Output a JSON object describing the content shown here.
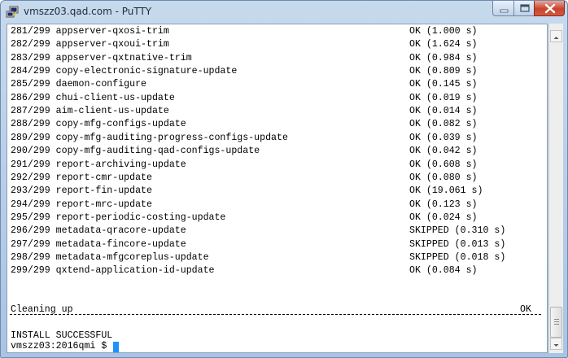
{
  "window": {
    "title": "vmszz03.qad.com - PuTTY",
    "accent": "#1e90ff"
  },
  "terminal": {
    "lines": [
      {
        "step": "281/299",
        "name": "appserver-qxosi-trim",
        "status": "OK (1.000 s)"
      },
      {
        "step": "282/299",
        "name": "appserver-qxoui-trim",
        "status": "OK (1.624 s)"
      },
      {
        "step": "283/299",
        "name": "appserver-qxtnative-trim",
        "status": "OK (0.984 s)"
      },
      {
        "step": "284/299",
        "name": "copy-electronic-signature-update",
        "status": "OK (0.809 s)"
      },
      {
        "step": "285/299",
        "name": "daemon-configure",
        "status": "OK (0.145 s)"
      },
      {
        "step": "286/299",
        "name": "chui-client-us-update",
        "status": "OK (0.019 s)"
      },
      {
        "step": "287/299",
        "name": "aim-client-us-update",
        "status": "OK (0.014 s)"
      },
      {
        "step": "288/299",
        "name": "copy-mfg-configs-update",
        "status": "OK (0.082 s)"
      },
      {
        "step": "289/299",
        "name": "copy-mfg-auditing-progress-configs-update",
        "status": "OK (0.039 s)"
      },
      {
        "step": "290/299",
        "name": "copy-mfg-auditing-qad-configs-update",
        "status": "OK (0.042 s)"
      },
      {
        "step": "291/299",
        "name": "report-archiving-update",
        "status": "OK (0.608 s)"
      },
      {
        "step": "292/299",
        "name": "report-cmr-update",
        "status": "OK (0.080 s)"
      },
      {
        "step": "293/299",
        "name": "report-fin-update",
        "status": "OK (19.061 s)"
      },
      {
        "step": "294/299",
        "name": "report-mrc-update",
        "status": "OK (0.123 s)"
      },
      {
        "step": "295/299",
        "name": "report-periodic-costing-update",
        "status": "OK (0.024 s)"
      },
      {
        "step": "296/299",
        "name": "metadata-qracore-update",
        "status": "SKIPPED (0.310 s)"
      },
      {
        "step": "297/299",
        "name": "metadata-fincore-update",
        "status": "SKIPPED (0.013 s)"
      },
      {
        "step": "298/299",
        "name": "metadata-mfgcoreplus-update",
        "status": "SKIPPED (0.018 s)"
      },
      {
        "step": "299/299",
        "name": "qxtend-application-id-update",
        "status": "OK (0.084 s)"
      }
    ],
    "cleaning_label": "Cleaning up",
    "cleaning_status": "OK",
    "result": "INSTALL SUCCESSFUL",
    "prompt": "vmszz03:2016qmi $ "
  }
}
